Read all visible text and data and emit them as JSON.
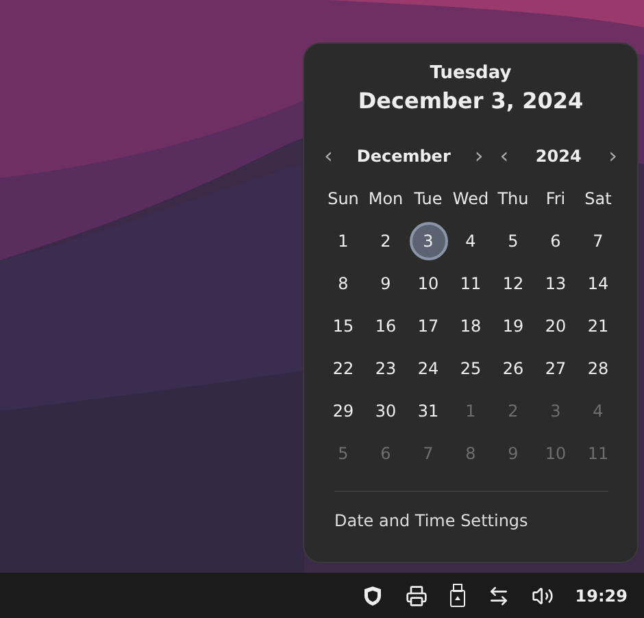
{
  "calendar": {
    "weekday": "Tuesday",
    "date": "December 3, 2024",
    "month_nav": {
      "prev": "‹",
      "label": "December",
      "next": "›"
    },
    "year_nav": {
      "prev": "‹",
      "label": "2024",
      "next": "›"
    },
    "weekdays": [
      "Sun",
      "Mon",
      "Tue",
      "Wed",
      "Thu",
      "Fri",
      "Sat"
    ],
    "weeks": [
      [
        {
          "day": "1",
          "current_month": true,
          "selected": false
        },
        {
          "day": "2",
          "current_month": true,
          "selected": false
        },
        {
          "day": "3",
          "current_month": true,
          "selected": true
        },
        {
          "day": "4",
          "current_month": true,
          "selected": false
        },
        {
          "day": "5",
          "current_month": true,
          "selected": false
        },
        {
          "day": "6",
          "current_month": true,
          "selected": false
        },
        {
          "day": "7",
          "current_month": true,
          "selected": false
        }
      ],
      [
        {
          "day": "8",
          "current_month": true,
          "selected": false
        },
        {
          "day": "9",
          "current_month": true,
          "selected": false
        },
        {
          "day": "10",
          "current_month": true,
          "selected": false
        },
        {
          "day": "11",
          "current_month": true,
          "selected": false
        },
        {
          "day": "12",
          "current_month": true,
          "selected": false
        },
        {
          "day": "13",
          "current_month": true,
          "selected": false
        },
        {
          "day": "14",
          "current_month": true,
          "selected": false
        }
      ],
      [
        {
          "day": "15",
          "current_month": true,
          "selected": false
        },
        {
          "day": "16",
          "current_month": true,
          "selected": false
        },
        {
          "day": "17",
          "current_month": true,
          "selected": false
        },
        {
          "day": "18",
          "current_month": true,
          "selected": false
        },
        {
          "day": "19",
          "current_month": true,
          "selected": false
        },
        {
          "day": "20",
          "current_month": true,
          "selected": false
        },
        {
          "day": "21",
          "current_month": true,
          "selected": false
        }
      ],
      [
        {
          "day": "22",
          "current_month": true,
          "selected": false
        },
        {
          "day": "23",
          "current_month": true,
          "selected": false
        },
        {
          "day": "24",
          "current_month": true,
          "selected": false
        },
        {
          "day": "25",
          "current_month": true,
          "selected": false
        },
        {
          "day": "26",
          "current_month": true,
          "selected": false
        },
        {
          "day": "27",
          "current_month": true,
          "selected": false
        },
        {
          "day": "28",
          "current_month": true,
          "selected": false
        }
      ],
      [
        {
          "day": "29",
          "current_month": true,
          "selected": false
        },
        {
          "day": "30",
          "current_month": true,
          "selected": false
        },
        {
          "day": "31",
          "current_month": true,
          "selected": false
        },
        {
          "day": "1",
          "current_month": false,
          "selected": false
        },
        {
          "day": "2",
          "current_month": false,
          "selected": false
        },
        {
          "day": "3",
          "current_month": false,
          "selected": false
        },
        {
          "day": "4",
          "current_month": false,
          "selected": false
        }
      ],
      [
        {
          "day": "5",
          "current_month": false,
          "selected": false
        },
        {
          "day": "6",
          "current_month": false,
          "selected": false
        },
        {
          "day": "7",
          "current_month": false,
          "selected": false
        },
        {
          "day": "8",
          "current_month": false,
          "selected": false
        },
        {
          "day": "9",
          "current_month": false,
          "selected": false
        },
        {
          "day": "10",
          "current_month": false,
          "selected": false
        },
        {
          "day": "11",
          "current_month": false,
          "selected": false
        }
      ]
    ],
    "settings_link": "Date and Time Settings"
  },
  "taskbar": {
    "tray": [
      {
        "kind": "shield"
      },
      {
        "kind": "printer"
      },
      {
        "kind": "usb"
      },
      {
        "kind": "network"
      },
      {
        "kind": "volume"
      }
    ],
    "clock": "19:29"
  }
}
